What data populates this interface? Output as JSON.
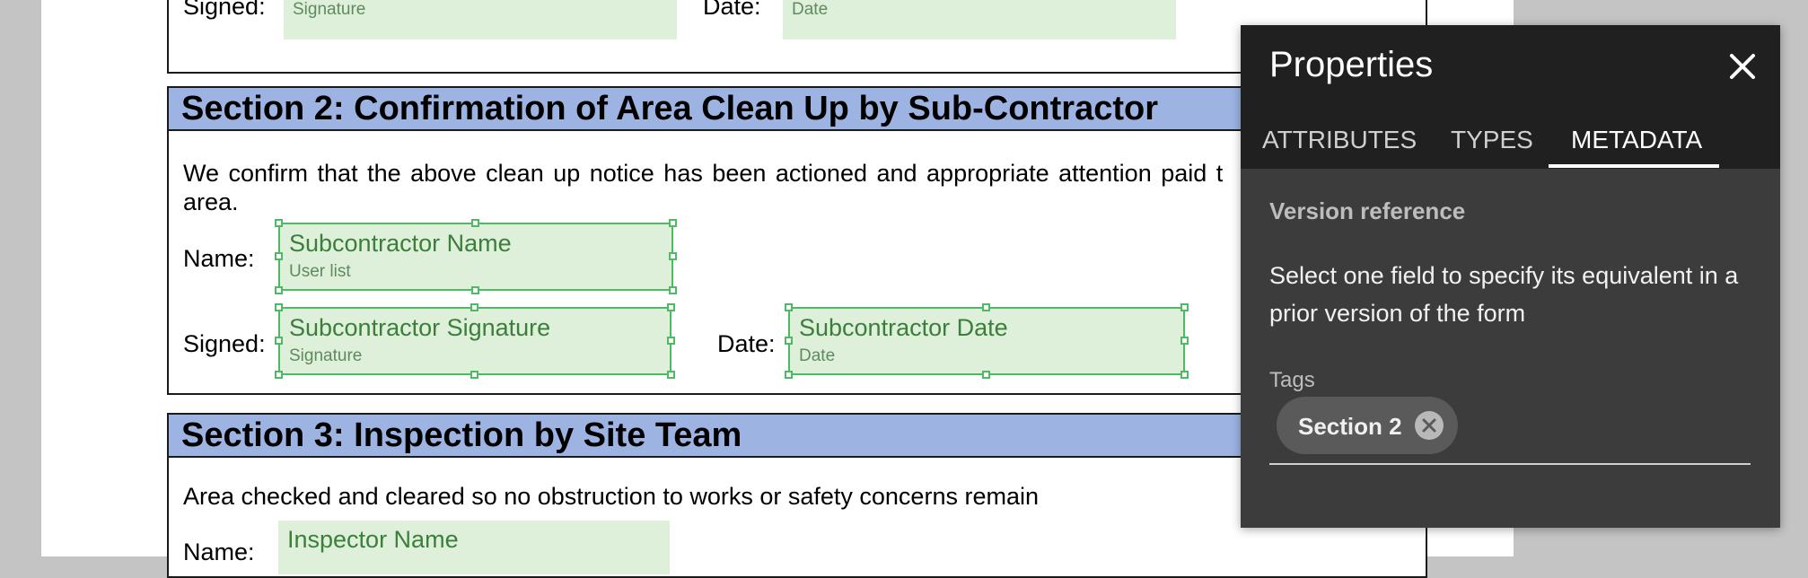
{
  "section1_tail": {
    "signed_label": "Signed:",
    "date_label": "Date:",
    "signature_field": {
      "sub": "Signature"
    },
    "date_field": {
      "sub": "Date"
    }
  },
  "section2": {
    "header": "Section 2: Confirmation of Area Clean Up by Sub-Contractor",
    "body_line1": "We confirm that the above clean up notice has been actioned and appropriate attention paid t",
    "body_line2": "area.",
    "name_label": "Name:",
    "signed_label": "Signed:",
    "date_label": "Date:",
    "name_field": {
      "title": "Subcontractor Name",
      "sub": "User list"
    },
    "signature_field": {
      "title": "Subcontractor Signature",
      "sub": "Signature"
    },
    "date_field": {
      "title": "Subcontractor Date",
      "sub": "Date"
    }
  },
  "section3": {
    "header": "Section 3: Inspection by Site Team",
    "body_line1": "Area checked and cleared so no obstruction to works or safety concerns remain",
    "name_label": "Name:",
    "name_field": {
      "title": "Inspector Name"
    }
  },
  "properties_panel": {
    "title": "Properties",
    "close_icon": "close-icon",
    "tabs": [
      "ATTRIBUTES",
      "TYPES",
      "METADATA"
    ],
    "active_tab": "METADATA",
    "version_reference_label": "Version reference",
    "version_reference_desc": "Select one field to specify its equivalent in a prior version of the form",
    "tags_label": "Tags",
    "tags": [
      {
        "label": "Section 2",
        "remove_icon": "remove-tag-icon"
      }
    ]
  },
  "colors": {
    "section_header_bg": "#9db4e3",
    "field_bg": "#def0da",
    "field_text": "#3b7f3b",
    "selection_border": "#4dbb63",
    "panel_bg": "#3c3c3c",
    "panel_header_bg": "#202020"
  }
}
